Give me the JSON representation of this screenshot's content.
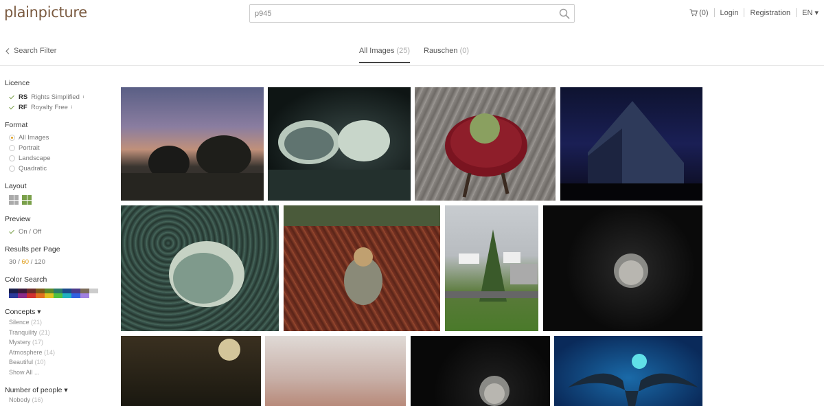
{
  "header": {
    "logo": "plainpicture",
    "search_value": "p945",
    "cart_label": "(0)",
    "login_label": "Login",
    "registration_label": "Registration",
    "language_label": "EN ▾"
  },
  "tabs": {
    "filter_back_label": "Search Filter",
    "all_images_label": "All Images",
    "all_images_count": "(25)",
    "rauschen_label": "Rauschen",
    "rauschen_count": "(0)"
  },
  "sidebar": {
    "licence_title": "Licence",
    "licences": [
      {
        "code": "RS",
        "label": "Rights Simplified",
        "sup": "i"
      },
      {
        "code": "RF",
        "label": "Royalty Free",
        "sup": "i"
      }
    ],
    "format_title": "Format",
    "formats": [
      "All Images",
      "Portrait",
      "Landscape",
      "Quadratic"
    ],
    "layout_title": "Layout",
    "preview_title": "Preview",
    "preview_option": "On / Off",
    "results_title": "Results per Page",
    "results_30": "30",
    "results_sep1": " / ",
    "results_60": "60",
    "results_sep2": " / ",
    "results_120": "120",
    "color_search_title": "Color Search",
    "concepts_title": "Concepts ▾",
    "concepts": [
      {
        "label": "Silence",
        "count": "(21)"
      },
      {
        "label": "Tranquility",
        "count": "(21)"
      },
      {
        "label": "Mystery",
        "count": "(17)"
      },
      {
        "label": "Atmosphere",
        "count": "(14)"
      },
      {
        "label": "Beautiful",
        "count": "(10)"
      }
    ],
    "show_all": "Show All ...",
    "people_title": "Number of people ▾",
    "people_first": "Nobody",
    "people_first_count": "(16)"
  },
  "colors": {
    "accent_green": "#7aa04a",
    "results_active": "#e0a020",
    "swatch_top": [
      "#1a1f4a",
      "#3a1a3a",
      "#6a2a2a",
      "#7a5a1a",
      "#5a8a2a",
      "#2a7a6a",
      "#1a4a8a",
      "#4a3a8a",
      "#7a6a5a",
      "#cccccc"
    ],
    "swatch_bottom": [
      "#2a3a9a",
      "#8a2a8a",
      "#d03030",
      "#e07020",
      "#e0c020",
      "#50c040",
      "#20b0c0",
      "#3060e0",
      "#a080e0",
      "#ffffff"
    ]
  },
  "images": [
    {
      "id": "img1",
      "desc": "sunset-landscape"
    },
    {
      "id": "img2",
      "desc": "shells"
    },
    {
      "id": "img3",
      "desc": "stool-melon"
    },
    {
      "id": "img4",
      "desc": "barn-night"
    },
    {
      "id": "img5",
      "desc": "shell-closeup"
    },
    {
      "id": "img6",
      "desc": "child-ferns"
    },
    {
      "id": "img7",
      "desc": "tree-houses"
    },
    {
      "id": "img8",
      "desc": "child-dark"
    },
    {
      "id": "img9",
      "desc": "forest-sun"
    },
    {
      "id": "img10",
      "desc": "fog"
    },
    {
      "id": "img11",
      "desc": "child-dark-2"
    },
    {
      "id": "img12",
      "desc": "bird-blue"
    }
  ]
}
